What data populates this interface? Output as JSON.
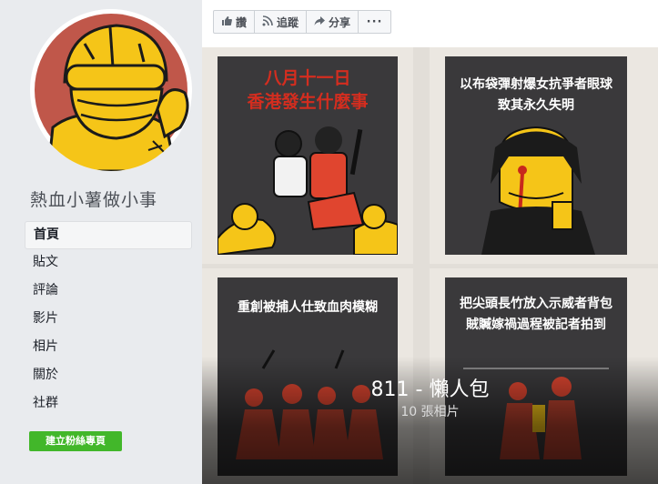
{
  "sidebar": {
    "page_name": "熱血小薯做小事",
    "nav": [
      {
        "label": "首頁"
      },
      {
        "label": "貼文"
      },
      {
        "label": "評論"
      },
      {
        "label": "影片"
      },
      {
        "label": "相片"
      },
      {
        "label": "關於"
      },
      {
        "label": "社群"
      }
    ],
    "create_page_label": "建立粉絲專頁"
  },
  "actions": {
    "like_label": "讚",
    "follow_label": "追蹤",
    "share_label": "分享",
    "more_label": "···",
    "like_icon": "thumbs-up-icon",
    "follow_icon": "rss-icon",
    "share_icon": "share-arrow-icon"
  },
  "album": {
    "title": "811 - 懶人包",
    "count": "10 張相片",
    "panels": [
      {
        "title_line1": "八月十一日",
        "title_line2": "香港發生什麼事",
        "title_color": "#d42d1f"
      },
      {
        "title_line1": "以布袋彈射爆女抗爭者眼球",
        "title_line2": "致其永久失明"
      },
      {
        "title_line1": "重創被捕人仕致血肉模糊",
        "title_line2": ""
      },
      {
        "title_line1": "把尖頭長竹放入示威者背包",
        "title_line2": "賊贓嫁禍過程被記者拍到"
      }
    ]
  },
  "colors": {
    "sidebar_bg": "#e9ebee",
    "create_button": "#42b72a",
    "avatar_ring": "#c0574a",
    "illustration_yellow": "#f5c518",
    "title_red": "#d42d1f"
  }
}
